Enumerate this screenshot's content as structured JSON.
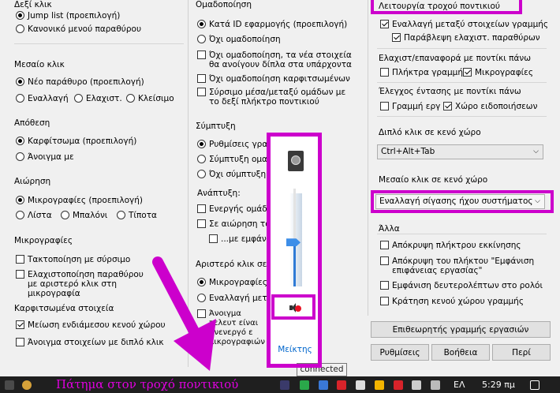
{
  "col1": {
    "left_click": {
      "title": "Δεξί κλικ",
      "options": [
        "Jump list (προεπιλογή)",
        "Κανονικό μενού παραθύρου"
      ],
      "selected": 0
    },
    "middle_click": {
      "title": "Μεσαίο κλικ",
      "options": [
        "Νέο παράθυρο (προεπιλογή)",
        "Εναλλαγή",
        "Ελαχιστ.",
        "Κλείσιμο"
      ],
      "selected": 0
    },
    "drop": {
      "title": "Απόθεση",
      "options": [
        "Καρφίτσωμα (προεπιλογή)",
        "Άνοιγμα με"
      ],
      "selected": 0
    },
    "hover": {
      "title": "Αιώρηση",
      "options": [
        "Μικρογραφίες (προεπιλογή)",
        "Λίστα",
        "Μπαλόνι",
        "Τίποτα"
      ],
      "selected": 0
    },
    "thumbnails": {
      "title": "Μικρογραφίες",
      "items": [
        "Τακτοποίηση με σύρσιμο",
        "Ελαχιστοποίηση παραθύρου με αριστερό κλικ στη μικρογραφία"
      ],
      "checked": [
        false,
        false
      ]
    },
    "pinned": {
      "title": "Καρφιτσωμένα στοιχεία",
      "items": [
        "Μείωση ενδιάμεσου κενού χώρου",
        "Άνοιγμα στοιχείων με διπλό κλικ"
      ],
      "checked": [
        true,
        false
      ]
    }
  },
  "col2": {
    "grouping": {
      "title": "Ομαδοποίηση",
      "options": [
        "Κατά ID εφαρμογής (προεπιλογή)",
        "Όχι ομαδοποίηση"
      ],
      "selected": 0,
      "checks": [
        "Όχι ομαδοποίηση, τα νέα στοιχεία θα ανοίγουν δίπλα στα υπάρχοντα",
        "Όχι ομαδοποίηση καρφιτσωμένων",
        "Σύρσιμο μέσα/μεταξύ ομάδων με το δεξί πλήκτρο ποντικιού"
      ]
    },
    "combine": {
      "title": "Σύμπτυξη",
      "options": [
        "Ρυθμίσεις γραμ",
        "Σύμπτυξη ομαδ",
        "Όχι σύμπτυξη ο"
      ],
      "selected": 0
    },
    "expand": {
      "title": "Ανάπτυξη:",
      "checks": [
        "Ενεργής ομάδα",
        "Σε αιώρηση του",
        "...με εμφάν"
      ]
    },
    "left_click": {
      "title": "Αριστερό κλικ σε συ",
      "options": [
        "Μικρογραφίες (",
        "Εναλλαγή μεταξ"
      ],
      "selected": 0,
      "check": "Άνοιγμα τελευτ είναι ανενεργό ε μικρογραφιών"
    }
  },
  "col3": {
    "wheel": {
      "title": "Λειτουργία τροχού ποντικιού",
      "checks": [
        "Εναλλαγή μεταξύ στοιχείων γραμμής",
        "Παράβλεψη ελαχιστ. παραθύρων"
      ],
      "checked": [
        true,
        true
      ]
    },
    "minrestore": {
      "title": "Ελαχιστ/επαναφορά με ποντίκι πάνω",
      "checks": [
        "Πλήκτρα γραμμής",
        "Μικρογραφίες"
      ],
      "checked": [
        false,
        true
      ]
    },
    "volume": {
      "title": "Έλεγχος έντασης με ποντίκι πάνω",
      "checks": [
        "Γραμμή εργ",
        "Χώρο ειδοποιήσεων"
      ],
      "checked": [
        false,
        true
      ]
    },
    "dblclick": {
      "title": "Διπλό κλικ σε κενό χώρο",
      "value": "Ctrl+Alt+Tab"
    },
    "midclick": {
      "title": "Μεσαίο κλικ σε κενό χώρο",
      "value": "Εναλλαγή σίγασης ήχου συστήματος"
    },
    "other": {
      "title": "Άλλα",
      "checks": [
        "Απόκρυψη πλήκτρου εκκίνησης",
        "Απόκρυψη του πλήκτου \"Εμφάνιση επιφάνειας εργασίας\"",
        "Εμφάνιση δευτερολέπτων στο ρολόι",
        "Κράτηση κενού χώρου γραμμής"
      ],
      "checked": [
        false,
        false,
        false,
        false
      ]
    },
    "inspector_button": "Επιθεωρητής γραμμής εργασιών",
    "buttons": [
      "Ρυθμίσεις",
      "Βοήθεια",
      "Περί"
    ]
  },
  "mixer": {
    "link": "Μείκτης",
    "level": 0.45
  },
  "tooltip": "connected",
  "annotation": "Πάτημα στον τροχό ποντικιού",
  "taskbar": {
    "lang": "ΕΛ",
    "time": "5:29 πμ"
  },
  "colors": {
    "highlight": "#cc00cc",
    "taskbar": "#1f1f1f"
  }
}
